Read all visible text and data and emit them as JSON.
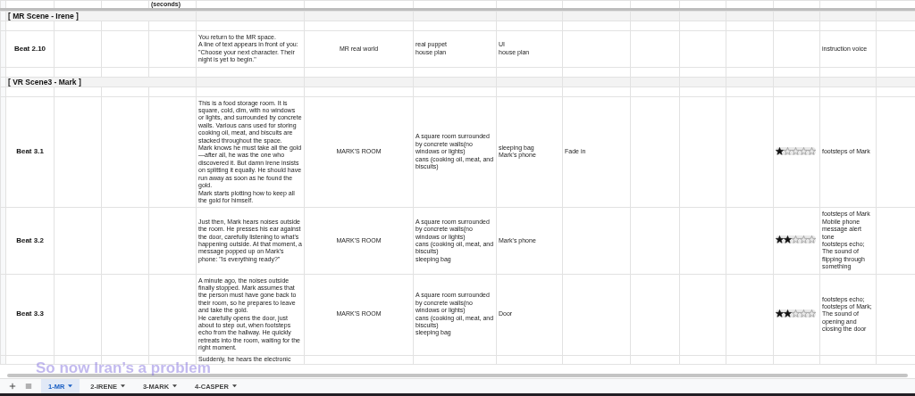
{
  "sheet": {
    "header_row": {
      "column_4": "(seconds)"
    },
    "rows": [
      {
        "kind": "section",
        "title": "[ MR Scene - Irene ]"
      },
      {
        "kind": "spacer"
      },
      {
        "kind": "beat",
        "cells": {
          "column_1": "Beat 2.10",
          "column_5": "You return to the MR space.\nA line of text appears in front of you: \"Choose your next character. Their night is yet to begin.\"",
          "column_6": "MR real world",
          "column_7": "real puppet\nhouse plan",
          "column_8": "UI\nhouse plan",
          "column_14": "instruction voice"
        }
      },
      {
        "kind": "spacer"
      },
      {
        "kind": "section",
        "title": "[ VR Scene3 - Mark ]"
      },
      {
        "kind": "spacer"
      },
      {
        "kind": "beat",
        "stars": 1,
        "cells": {
          "column_1": "Beat 3.1",
          "column_5": "This is a food storage room. It is square, cold, dim, with no windows or lights, and surrounded by concrete walls. Various cans used for storing cooking oil, meat, and biscuits are stacked throughout the space.\nMark knows he must take all the gold—after all, he was the one who discovered it. But damn Irene insists on splitting it equally. He should have run away as soon as he found the gold.\nMark starts plotting how to keep all the gold for himself.",
          "column_6": "MARK'S ROOM",
          "column_7": "A square room surrounded by concrete walls(no windows or lights)\ncans (cooking oil, meat, and biscuits)",
          "column_8": "sleeping bag\nMark's phone",
          "column_9": "Fade in",
          "column_14": "footsteps of Mark"
        }
      },
      {
        "kind": "beat",
        "stars": 2,
        "cells": {
          "column_1": "Beat 3.2",
          "column_5": "Just then, Mark hears noises outside the room. He presses his ear against the door, carefully listening to what's happening outside. At that moment, a message popped up on Mark's phone: \"Is everything ready?\"",
          "column_6": "MARK'S ROOM",
          "column_7": "A square room surrounded by concrete walls(no windows or lights)\ncans (cooking oil, meat, and biscuits)\nsleeping bag",
          "column_8": "Mark's phone",
          "column_14": "footsteps of Mark\nMobile phone message alert tone\nfootsteps echo; The sound of flipping through something"
        }
      },
      {
        "kind": "beat",
        "stars": 2,
        "cells": {
          "column_1": "Beat 3.3",
          "column_5": "A minute ago, the noises outside finally stopped. Mark assumes that the person must have gone back to their room, so he prepares to leave and take the gold.\nHe carefully opens the door, just about to step out, when footsteps echo from the hallway. He quickly retreats into the room, waiting for the right moment.",
          "column_6": "MARK'S ROOM",
          "column_7": "A square room surrounded by concrete walls(no windows or lights)\ncans (cooking oil, meat, and biscuits)\nsleeping bag",
          "column_8": "Door",
          "column_14": "footsteps echo; footsteps of Mark; The sound of opening and closing the door"
        }
      },
      {
        "kind": "partial",
        "cells": {
          "column_5": "Suddenly, he hears the electronic"
        }
      }
    ]
  },
  "sheet_tabs": [
    {
      "label": "1-MR",
      "selected": true
    },
    {
      "label": "2-IRENE",
      "selected": false
    },
    {
      "label": "3-MARK",
      "selected": false
    },
    {
      "label": "4-CASPER",
      "selected": false
    }
  ],
  "caption": "So now Iran’s a problem"
}
